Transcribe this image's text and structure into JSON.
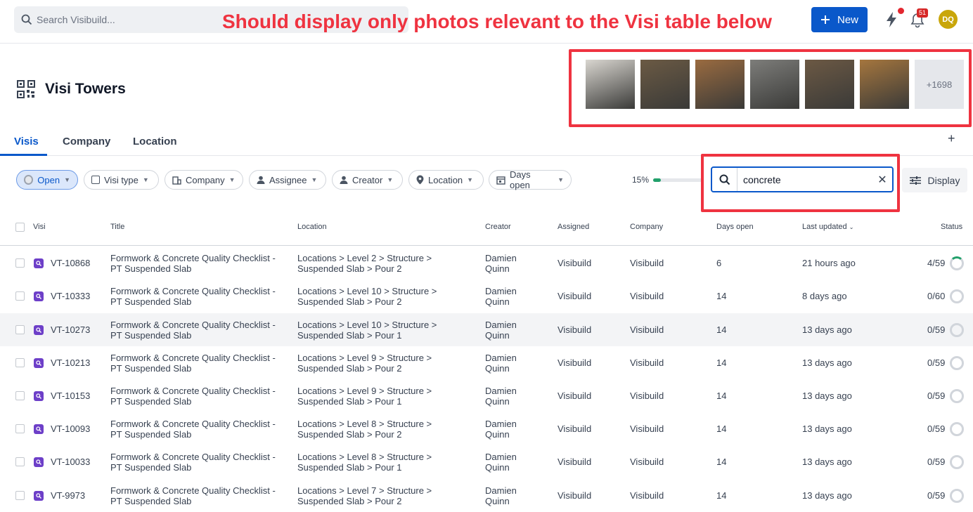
{
  "search": {
    "placeholder": "Search Visibuild..."
  },
  "annotation": "Should display only photos relevant to the Visi table below",
  "header": {
    "new_label": "New",
    "notifications_count": "51",
    "avatar_initials": "DQ"
  },
  "project": {
    "title": "Visi Towers"
  },
  "photos": {
    "more_label": "+1698",
    "thumbs": [
      "#d9d6d0",
      "#6b5a44",
      "#9a6b40",
      "#7d7d7a",
      "#6c5944",
      "#a5763e"
    ]
  },
  "tabs": [
    "Visis",
    "Company",
    "Location"
  ],
  "filters": {
    "open": "Open",
    "visi_type": "Visi type",
    "company": "Company",
    "assignee": "Assignee",
    "creator": "Creator",
    "location": "Location",
    "days_open": "Days open",
    "progress_label": "15%",
    "progress_value": 0.15,
    "search_value": "concrete",
    "display_label": "Display"
  },
  "table": {
    "headers": {
      "visi": "Visi",
      "title": "Title",
      "location": "Location",
      "creator": "Creator",
      "assigned": "Assigned",
      "company": "Company",
      "days_open": "Days open",
      "last_updated": "Last updated",
      "status": "Status"
    },
    "rows": [
      {
        "id": "VT-10868",
        "title1": "Formwork & Concrete Quality Checklist -",
        "title2": "PT Suspended Slab",
        "loc1": "Locations > Level 2 > Structure >",
        "loc2": "Suspended Slab > Pour 2",
        "creator1": "Damien",
        "creator2": "Quinn",
        "assigned": "Visibuild",
        "company": "Visibuild",
        "days": "6",
        "updated": "21 hours ago",
        "status": "4/59"
      },
      {
        "id": "VT-10333",
        "title1": "Formwork & Concrete Quality Checklist -",
        "title2": "PT Suspended Slab",
        "loc1": "Locations > Level 10 > Structure >",
        "loc2": "Suspended Slab > Pour 2",
        "creator1": "Damien",
        "creator2": "Quinn",
        "assigned": "Visibuild",
        "company": "Visibuild",
        "days": "14",
        "updated": "8 days ago",
        "status": "0/60"
      },
      {
        "id": "VT-10273",
        "title1": "Formwork & Concrete Quality Checklist -",
        "title2": "PT Suspended Slab",
        "loc1": "Locations > Level 10 > Structure >",
        "loc2": "Suspended Slab > Pour 1",
        "creator1": "Damien",
        "creator2": "Quinn",
        "assigned": "Visibuild",
        "company": "Visibuild",
        "days": "14",
        "updated": "13 days ago",
        "status": "0/59"
      },
      {
        "id": "VT-10213",
        "title1": "Formwork & Concrete Quality Checklist -",
        "title2": "PT Suspended Slab",
        "loc1": "Locations > Level 9 > Structure >",
        "loc2": "Suspended Slab > Pour 2",
        "creator1": "Damien",
        "creator2": "Quinn",
        "assigned": "Visibuild",
        "company": "Visibuild",
        "days": "14",
        "updated": "13 days ago",
        "status": "0/59"
      },
      {
        "id": "VT-10153",
        "title1": "Formwork & Concrete Quality Checklist -",
        "title2": "PT Suspended Slab",
        "loc1": "Locations > Level 9 > Structure >",
        "loc2": "Suspended Slab > Pour 1",
        "creator1": "Damien",
        "creator2": "Quinn",
        "assigned": "Visibuild",
        "company": "Visibuild",
        "days": "14",
        "updated": "13 days ago",
        "status": "0/59"
      },
      {
        "id": "VT-10093",
        "title1": "Formwork & Concrete Quality Checklist -",
        "title2": "PT Suspended Slab",
        "loc1": "Locations > Level 8 > Structure >",
        "loc2": "Suspended Slab > Pour 2",
        "creator1": "Damien",
        "creator2": "Quinn",
        "assigned": "Visibuild",
        "company": "Visibuild",
        "days": "14",
        "updated": "13 days ago",
        "status": "0/59"
      },
      {
        "id": "VT-10033",
        "title1": "Formwork & Concrete Quality Checklist -",
        "title2": "PT Suspended Slab",
        "loc1": "Locations > Level 8 > Structure >",
        "loc2": "Suspended Slab > Pour 1",
        "creator1": "Damien",
        "creator2": "Quinn",
        "assigned": "Visibuild",
        "company": "Visibuild",
        "days": "14",
        "updated": "13 days ago",
        "status": "0/59"
      },
      {
        "id": "VT-9973",
        "title1": "Formwork & Concrete Quality Checklist -",
        "title2": "PT Suspended Slab",
        "loc1": "Locations > Level 7 > Structure >",
        "loc2": "Suspended Slab > Pour 2",
        "creator1": "Damien",
        "creator2": "Quinn",
        "assigned": "Visibuild",
        "company": "Visibuild",
        "days": "14",
        "updated": "13 days ago",
        "status": "0/59"
      }
    ]
  }
}
